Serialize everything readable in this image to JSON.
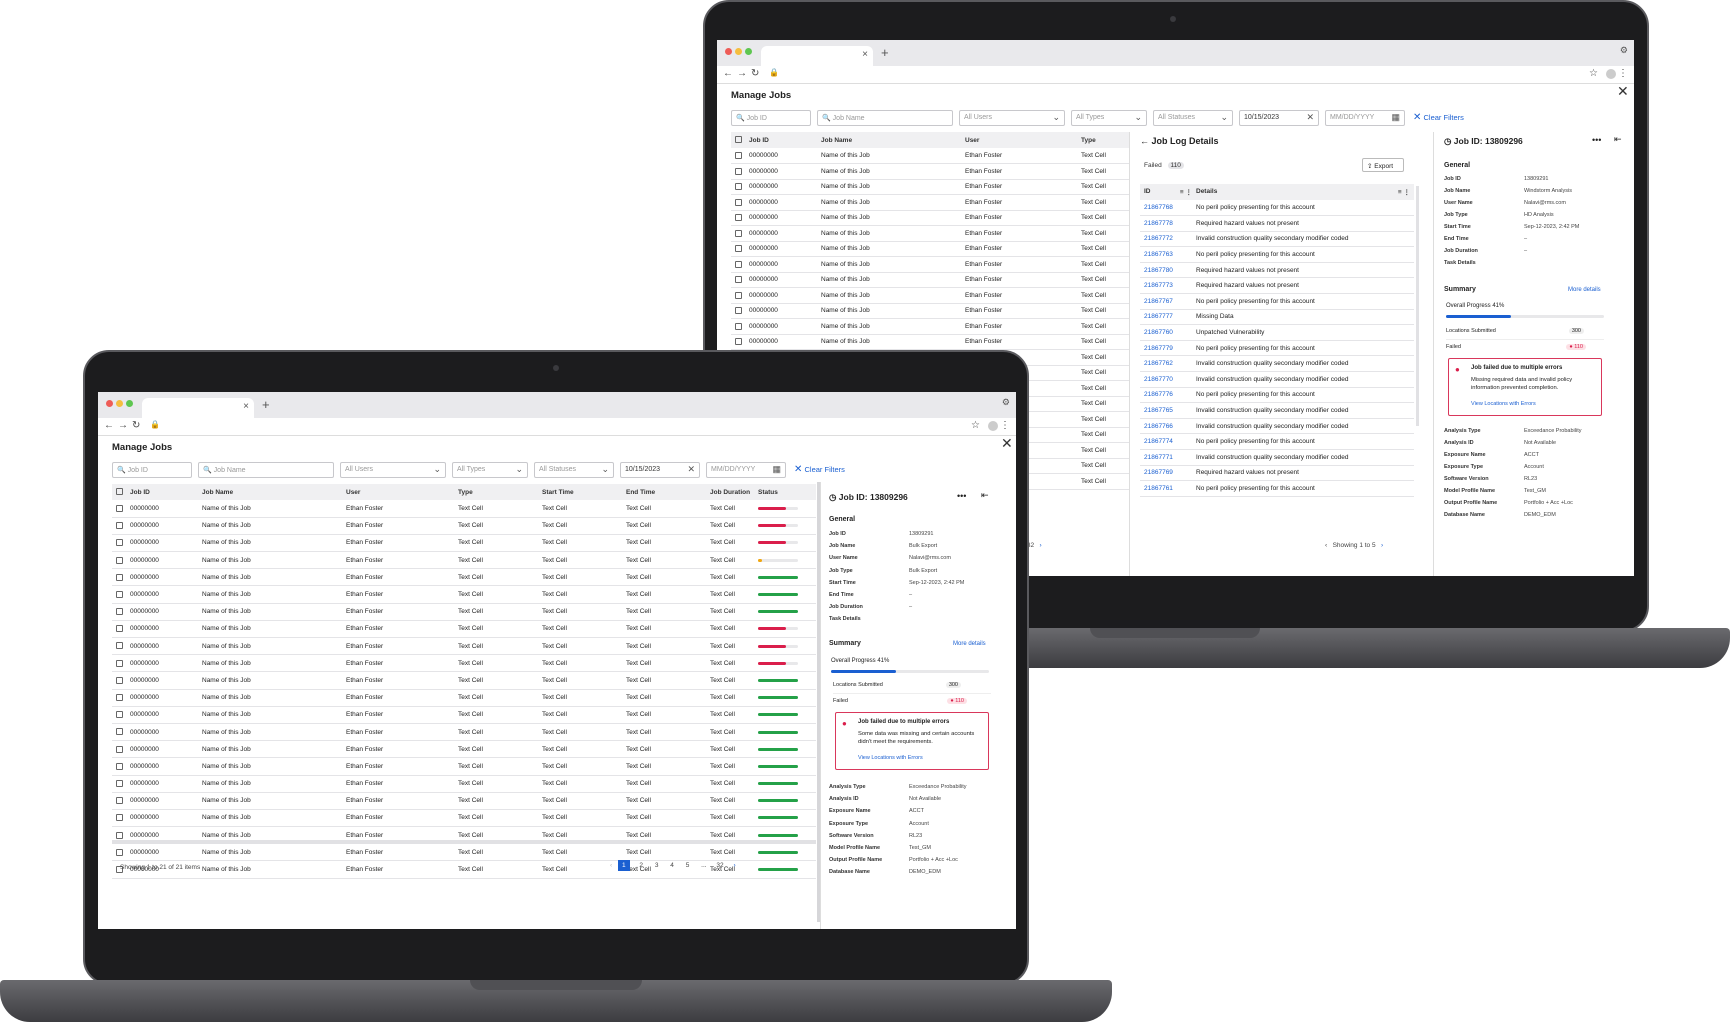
{
  "window": {
    "title": "Manage Jobs",
    "clear_filters": "Clear Filters"
  },
  "filters": {
    "job_id_placeholder": "Job ID",
    "job_name_placeholder": "Job Name",
    "users": "All Users",
    "types": "All Types",
    "statuses": "All Statuses",
    "start_date": "10/15/2023",
    "end_date_placeholder": "MM/DD/YYYY"
  },
  "table": {
    "headers": [
      "Job ID",
      "Job Name",
      "User",
      "Type",
      "Start Time",
      "End Time",
      "Job Duration",
      "Status"
    ],
    "cell": {
      "id": "00000000",
      "name": "Name of this Job",
      "user": "Ethan Foster",
      "text": "Text Cell"
    },
    "statuses": [
      {
        "progress": 0.7,
        "color": "#da1e4b"
      },
      {
        "progress": 0.7,
        "color": "#da1e4b"
      },
      {
        "progress": 0.7,
        "color": "#da1e4b"
      },
      {
        "progress": 0.1,
        "color": "#f1a60f"
      },
      {
        "progress": 1.0,
        "color": "#24a148"
      },
      {
        "progress": 1.0,
        "color": "#24a148"
      },
      {
        "progress": 1.0,
        "color": "#24a148"
      },
      {
        "progress": 0.7,
        "color": "#da1e4b"
      },
      {
        "progress": 0.7,
        "color": "#da1e4b"
      },
      {
        "progress": 0.7,
        "color": "#da1e4b"
      },
      {
        "progress": 1.0,
        "color": "#24a148"
      },
      {
        "progress": 1.0,
        "color": "#24a148"
      },
      {
        "progress": 1.0,
        "color": "#24a148"
      },
      {
        "progress": 1.0,
        "color": "#24a148"
      },
      {
        "progress": 1.0,
        "color": "#24a148"
      },
      {
        "progress": 1.0,
        "color": "#24a148"
      },
      {
        "progress": 1.0,
        "color": "#24a148"
      },
      {
        "progress": 1.0,
        "color": "#24a148"
      },
      {
        "progress": 1.0,
        "color": "#24a148"
      },
      {
        "progress": 1.0,
        "color": "#24a148"
      },
      {
        "progress": 1.0,
        "color": "#24a148"
      },
      {
        "progress": 1.0,
        "color": "#24a148"
      }
    ],
    "footer": "Showing 1 to 21 of 21 items",
    "pages": [
      "1",
      "2",
      "3",
      "4",
      "5",
      "...",
      "32"
    ]
  },
  "detail_front": {
    "title": "Job ID: 13809296",
    "general_heading": "General",
    "fields": [
      {
        "k": "Job ID",
        "v": "13809291"
      },
      {
        "k": "Job Name",
        "v": "Bulk Export"
      },
      {
        "k": "User Name",
        "v": "Nalavi@rms.com"
      },
      {
        "k": "Job Type",
        "v": "Bulk Export"
      },
      {
        "k": "Start Time",
        "v": "Sep-12-2023, 2:42 PM"
      },
      {
        "k": "End Time",
        "v": "–"
      },
      {
        "k": "Job Duration",
        "v": "–"
      },
      {
        "k": "Task Details",
        "v": ""
      }
    ],
    "summary_heading": "Summary",
    "more_details": "More details",
    "progress_label": "Overall Progress 41%",
    "progress": 0.41,
    "locations_label": "Locations Submitted",
    "locations_value": "300",
    "failed_label": "Failed",
    "failed_value": "110",
    "error_title": "Job failed due to multiple errors",
    "error_body": "Some data was missing and certain accounts didn't meet the requirements.",
    "error_link": "View Locations with Errors",
    "fields2": [
      {
        "k": "Analysis Type",
        "v": "Exceedance Probability"
      },
      {
        "k": "Analysis ID",
        "v": "Not Available"
      },
      {
        "k": "Exposure Name",
        "v": "ACCT"
      },
      {
        "k": "Exposure Type",
        "v": "Account"
      },
      {
        "k": "Software Version",
        "v": "RL23"
      },
      {
        "k": "Model Profile Name",
        "v": "Test_GM"
      },
      {
        "k": "Output Profile Name",
        "v": "Portfolio + Acc +Loc"
      },
      {
        "k": "Database Name",
        "v": "DEMO_EDM"
      }
    ]
  },
  "detail_back": {
    "title": "Job ID: 13809296",
    "fields": [
      {
        "k": "Job ID",
        "v": "13809291"
      },
      {
        "k": "Job Name",
        "v": "Windstorm Analysis"
      },
      {
        "k": "User Name",
        "v": "Nalavi@rms.com"
      },
      {
        "k": "Job Type",
        "v": "HD Analysis"
      },
      {
        "k": "Start Time",
        "v": "Sep-12-2023, 2:42 PM"
      },
      {
        "k": "End Time",
        "v": "–"
      },
      {
        "k": "Job Duration",
        "v": "–"
      },
      {
        "k": "Task Details",
        "v": ""
      }
    ],
    "error_body": "Missing required data and invalid policy information prevented completion.",
    "fields2": [
      {
        "k": "Analysis Type",
        "v": "Exceedance Probability"
      },
      {
        "k": "Analysis ID",
        "v": "Not Available"
      },
      {
        "k": "Exposure Name",
        "v": "ACCT"
      },
      {
        "k": "Exposure Type",
        "v": "Account"
      },
      {
        "k": "Software Version",
        "v": "RL23"
      },
      {
        "k": "Model Profile Name",
        "v": "Test_GM"
      },
      {
        "k": "Output Profile Name",
        "v": "Portfolio + Acc +Loc"
      },
      {
        "k": "Database Name",
        "v": "DEMO_EDM"
      }
    ]
  },
  "log": {
    "title": "Job Log Details",
    "failed_label": "Failed",
    "failed_count": "110",
    "export": "Export",
    "headers": [
      "ID",
      "Details"
    ],
    "rows": [
      {
        "id": "21867768",
        "d": "No peril policy presenting for this account"
      },
      {
        "id": "21867778",
        "d": "Required hazard values not present"
      },
      {
        "id": "21867772",
        "d": "Invalid construction quality secondary modifier coded"
      },
      {
        "id": "21867763",
        "d": "No peril policy presenting for this account"
      },
      {
        "id": "21867780",
        "d": "Required hazard values not present"
      },
      {
        "id": "21867773",
        "d": "Required hazard values not present"
      },
      {
        "id": "21867767",
        "d": "No peril policy presenting for this account"
      },
      {
        "id": "21867777",
        "d": "Missing Data"
      },
      {
        "id": "21867760",
        "d": "Unpatched Vulnerability"
      },
      {
        "id": "21867779",
        "d": "No peril policy presenting for this account"
      },
      {
        "id": "21867762",
        "d": "Invalid construction quality secondary modifier coded"
      },
      {
        "id": "21867770",
        "d": "Invalid construction quality secondary modifier coded"
      },
      {
        "id": "21867776",
        "d": "No peril policy presenting for this account"
      },
      {
        "id": "21867765",
        "d": "Invalid construction quality secondary modifier coded"
      },
      {
        "id": "21867766",
        "d": "Invalid construction quality secondary modifier coded"
      },
      {
        "id": "21867774",
        "d": "No peril policy presenting for this account"
      },
      {
        "id": "21867771",
        "d": "Invalid construction quality secondary modifier coded"
      },
      {
        "id": "21867769",
        "d": "Required hazard values not present"
      },
      {
        "id": "21867761",
        "d": "No peril policy presenting for this account"
      }
    ],
    "footer": "Showing 1 to 5"
  }
}
